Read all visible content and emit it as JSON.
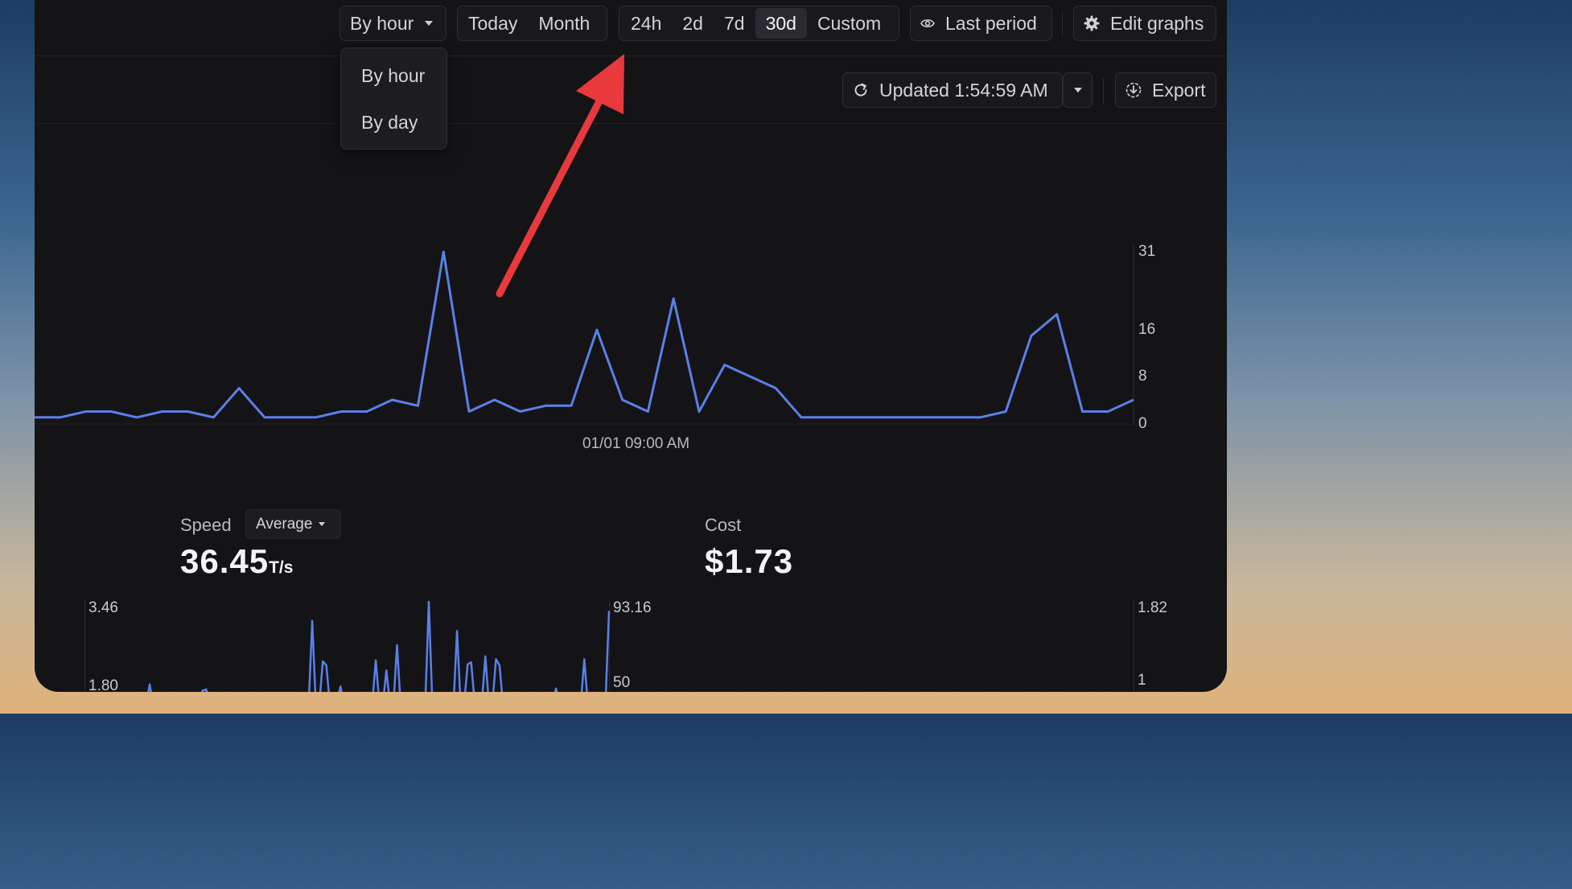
{
  "toolbar": {
    "group_by_selected": "By hour",
    "period_today": "Today",
    "period_month": "Month",
    "range_24h": "24h",
    "range_2d": "2d",
    "range_7d": "7d",
    "range_30d": "30d",
    "range_custom": "Custom",
    "compare_label": "Last period",
    "edit_graphs_label": "Edit graphs"
  },
  "group_by_menu": {
    "options": [
      "By hour",
      "By day"
    ]
  },
  "subtoolbar": {
    "updated_label": "Updated 1:54:59 AM",
    "export_label": "Export"
  },
  "accent_color": "#5b7fe8",
  "arrow_color": "#e8393d",
  "main_chart": {
    "x_label": "01/01 09:00 AM",
    "y_ticks": [
      "31",
      "16",
      "8",
      "0"
    ]
  },
  "stats": {
    "speed": {
      "label": "Speed",
      "aggregate": "Average",
      "value": "36.45",
      "unit": "T/s",
      "y_ticks_left": [
        "3.46",
        "1.80"
      ],
      "y_ticks_right": [
        "93.16",
        "50"
      ]
    },
    "cost": {
      "label": "Cost",
      "value": "$1.73",
      "y_ticks": [
        "1.82",
        "1"
      ]
    }
  },
  "chart_data": [
    {
      "type": "line",
      "title": "",
      "xlabel": "01/01 09:00 AM",
      "ylabel": "",
      "yticks": [
        0,
        8,
        16,
        31
      ],
      "ylim": [
        0,
        31
      ],
      "series": [
        {
          "values": [
            1,
            1,
            2,
            2,
            1,
            2,
            2,
            1,
            6,
            1,
            1,
            1,
            2,
            2,
            4,
            3,
            31,
            2,
            4,
            2,
            3,
            3,
            16,
            4,
            2,
            22,
            2,
            10,
            8,
            6,
            1,
            1,
            1,
            1,
            1,
            1,
            1,
            1,
            2,
            15,
            19,
            2,
            2,
            4
          ]
        }
      ]
    },
    {
      "type": "line",
      "title": "",
      "ylabel": "",
      "yticks_left": [
        1.8,
        3.46
      ],
      "yticks_right": [
        50,
        93.16
      ],
      "series": [
        {
          "values": [
            0,
            0,
            0,
            0,
            0,
            0,
            0,
            0,
            0,
            0,
            0,
            0,
            0,
            0,
            0,
            0,
            0,
            0,
            1.82,
            0,
            0,
            0,
            0,
            0,
            0,
            0,
            0,
            0,
            0,
            0,
            0,
            0,
            0,
            1.7,
            1.72,
            0,
            0,
            0,
            0,
            0,
            0,
            0,
            0,
            0,
            0,
            0,
            0,
            0,
            0,
            0,
            0,
            0,
            0,
            0,
            0,
            0,
            0,
            0,
            0,
            0,
            0,
            0,
            0,
            0,
            3.08,
            0,
            0,
            2.28,
            2.2,
            0,
            0,
            0,
            1.78,
            0,
            0,
            0,
            0,
            0,
            0,
            0,
            0,
            0,
            2.3,
            0,
            0,
            2.1,
            0,
            0,
            2.6,
            0,
            0,
            0,
            0,
            0,
            0,
            0,
            0,
            3.46,
            0,
            0,
            0,
            0,
            0,
            0,
            0,
            2.88,
            0,
            0,
            2.22,
            2.26,
            0,
            0,
            0,
            2.38,
            0,
            0,
            2.32,
            2.2,
            0,
            0,
            0,
            0,
            0,
            0,
            0,
            0,
            0,
            0,
            0,
            0,
            0,
            0,
            0,
            1.74,
            0,
            0,
            0,
            0,
            0,
            0,
            0,
            2.32,
            0,
            0,
            0,
            0,
            0,
            0,
            3.28
          ]
        }
      ]
    },
    {
      "type": "line",
      "title": "",
      "ylabel": "",
      "yticks": [
        1,
        1.82
      ],
      "series": []
    }
  ]
}
